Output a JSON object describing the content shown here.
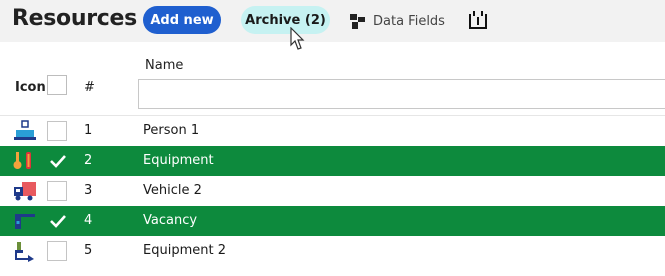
{
  "header": {
    "title": "Resources",
    "add_label": "Add new",
    "archive_label": "Archive (2)",
    "data_fields_label": "Data Fields"
  },
  "columns": {
    "icon": "Icon",
    "number": "#",
    "name": "Name"
  },
  "filter": {
    "value": "",
    "placeholder": ""
  },
  "colors": {
    "accent": "#1f5fcf",
    "archive": "#c6f2f2",
    "selected_row": "#0d8a3d"
  },
  "rows": [
    {
      "num": "1",
      "name": "Person 1",
      "icon": "person-icon",
      "selected": false
    },
    {
      "num": "2",
      "name": "Equipment",
      "icon": "equipment-icon",
      "selected": true
    },
    {
      "num": "3",
      "name": "Vehicle 2",
      "icon": "truck-icon",
      "selected": false
    },
    {
      "num": "4",
      "name": "Vacancy",
      "icon": "vacancy-icon",
      "selected": true
    },
    {
      "num": "5",
      "name": "Equipment 2",
      "icon": "machine-icon",
      "selected": false
    }
  ]
}
